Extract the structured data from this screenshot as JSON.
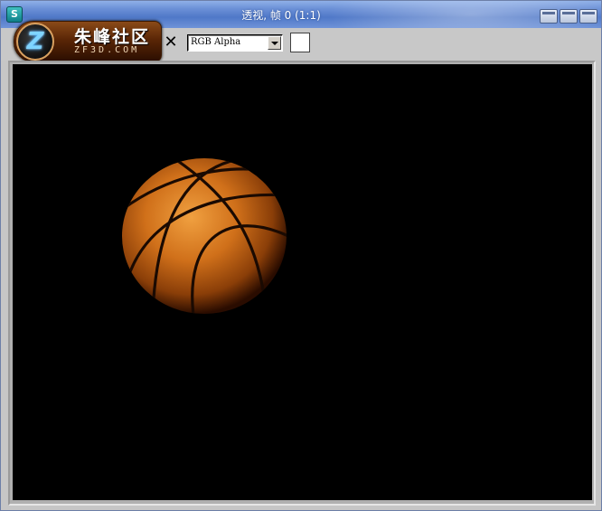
{
  "window": {
    "title": "透视, 帧 0 (1:1)",
    "app_icon_glyph": "S"
  },
  "logo": {
    "cn": "朱峰社区",
    "en": "ZF3D.COM",
    "letter": "Z"
  },
  "toolbar": {
    "close_glyph": "✕",
    "channel_value": "RGB Alpha",
    "swatch_color": "#ffffff"
  },
  "render": {
    "background_color": "#000000",
    "subject": "basketball-icon",
    "ball_color": "#e07a1a"
  }
}
